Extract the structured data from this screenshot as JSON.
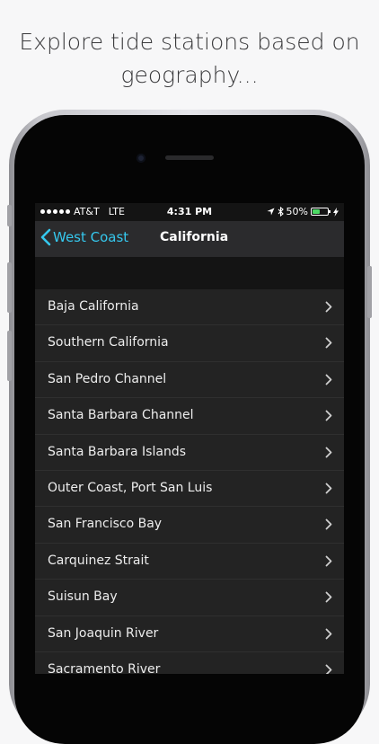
{
  "caption": {
    "line1": "Explore tide stations based on",
    "line2": "geography..."
  },
  "status_bar": {
    "carrier": "AT&T",
    "network": "LTE",
    "time": "4:31 PM",
    "battery": "50%",
    "battery_level": 0.5,
    "icons": [
      "signal-dots-icon",
      "location-arrow-icon",
      "bluetooth-icon",
      "battery-icon",
      "charging-bolt-icon"
    ]
  },
  "nav": {
    "back_label": "West Coast",
    "title": "California"
  },
  "colors": {
    "accent": "#35c8ee",
    "nav_background": "#2b2b2d",
    "list_background": "#232323",
    "battery_fill": "#4cd964"
  },
  "list": {
    "items": [
      {
        "label": "Baja California"
      },
      {
        "label": "Southern California"
      },
      {
        "label": "San Pedro Channel"
      },
      {
        "label": "Santa Barbara Channel"
      },
      {
        "label": "Santa Barbara Islands"
      },
      {
        "label": "Outer Coast, Port San Luis"
      },
      {
        "label": "San Francisco Bay"
      },
      {
        "label": "Carquinez Strait"
      },
      {
        "label": "Suisun Bay"
      },
      {
        "label": "San Joaquin River"
      },
      {
        "label": "Sacramento River"
      }
    ]
  }
}
